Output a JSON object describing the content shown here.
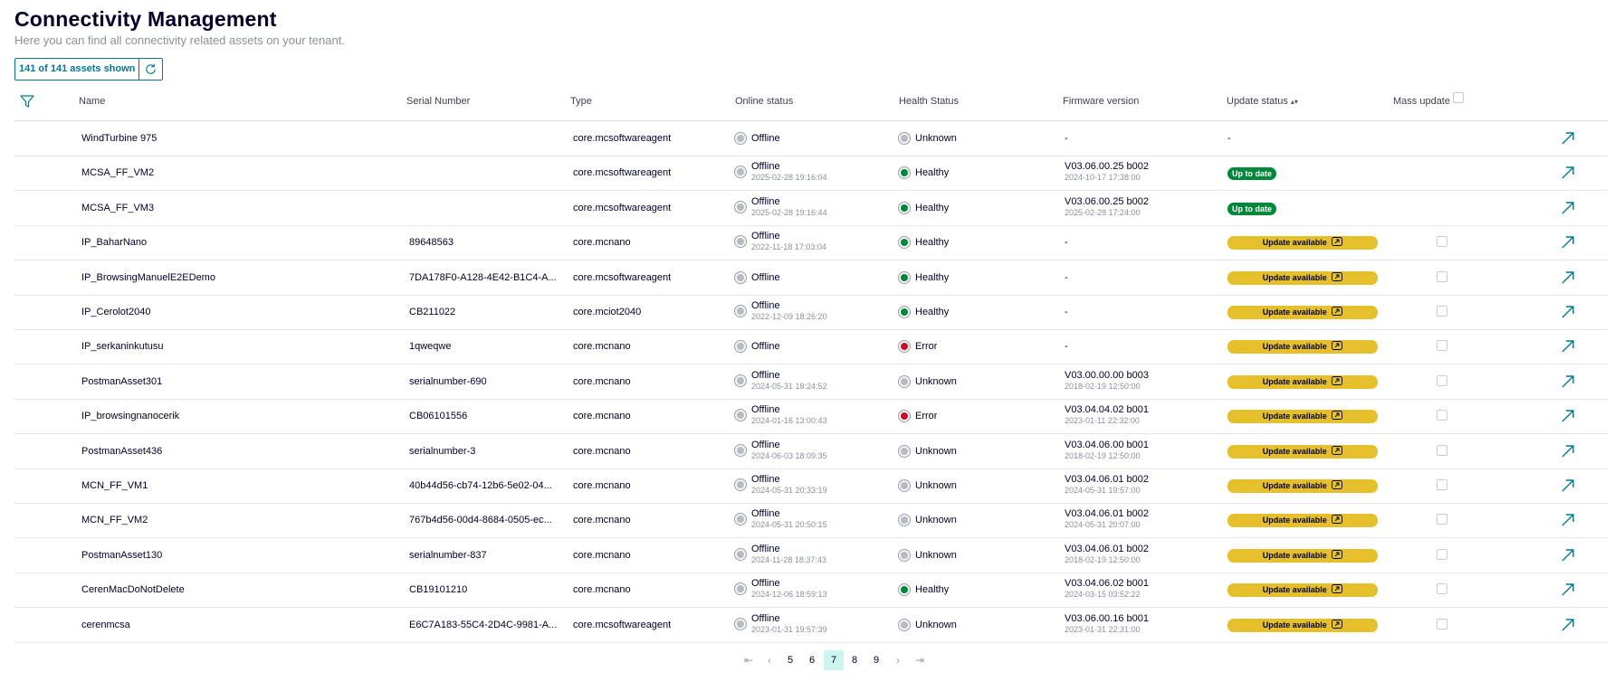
{
  "header": {
    "title": "Connectivity Management",
    "subtitle": "Here you can find all connectivity related assets on your tenant.",
    "count_label": "141 of 141 assets shown"
  },
  "columns": {
    "name": "Name",
    "serial": "Serial Number",
    "type": "Type",
    "online": "Online status",
    "health": "Health Status",
    "firmware": "Firmware version",
    "update": "Update status",
    "mass": "Mass update"
  },
  "colors": {
    "accent": "#007993",
    "healthy": "#00883a",
    "error": "#c8102e",
    "unknown": "#b7bcc2",
    "update_available": "#e6c02c"
  },
  "rows": [
    {
      "name": "WindTurbine 975",
      "serial": "",
      "type": "core.mcsoftwareagent",
      "online": "Offline",
      "online_time": "",
      "health": "Unknown",
      "firmware": "-",
      "firmware_date": "",
      "update": "-",
      "update_kind": "none"
    },
    {
      "name": "MCSA_FF_VM2",
      "serial": "",
      "type": "core.mcsoftwareagent",
      "online": "Offline",
      "online_time": "2025-02-28 19:16:04",
      "health": "Healthy",
      "firmware": "V03.06.00.25 b002",
      "firmware_date": "2024-10-17 17:38:00",
      "update": "Up to date",
      "update_kind": "uptodate"
    },
    {
      "name": "MCSA_FF_VM3",
      "serial": "",
      "type": "core.mcsoftwareagent",
      "online": "Offline",
      "online_time": "2025-02-28 19:16:44",
      "health": "Healthy",
      "firmware": "V03.06.00.25 b002",
      "firmware_date": "2025-02-28 17:24:00",
      "update": "Up to date",
      "update_kind": "uptodate"
    },
    {
      "name": "IP_BaharNano",
      "serial": "89648563",
      "type": "core.mcnano",
      "online": "Offline",
      "online_time": "2022-11-18 17:03:04",
      "health": "Healthy",
      "firmware": "-",
      "firmware_date": "",
      "update": "Update available",
      "update_kind": "available"
    },
    {
      "name": "IP_BrowsingManuelE2EDemo",
      "serial": "7DA178F0-A128-4E42-B1C4-A...",
      "type": "core.mcsoftwareagent",
      "online": "Offline",
      "online_time": "",
      "health": "Healthy",
      "firmware": "-",
      "firmware_date": "",
      "update": "Update available",
      "update_kind": "available"
    },
    {
      "name": "IP_Cerolot2040",
      "serial": "CB211022",
      "type": "core.mciot2040",
      "online": "Offline",
      "online_time": "2022-12-09 18:26:20",
      "health": "Healthy",
      "firmware": "-",
      "firmware_date": "",
      "update": "Update available",
      "update_kind": "available"
    },
    {
      "name": "IP_serkaninkutusu",
      "serial": "1qweqwe",
      "type": "core.mcnano",
      "online": "Offline",
      "online_time": "",
      "health": "Error",
      "firmware": "-",
      "firmware_date": "",
      "update": "Update available",
      "update_kind": "available"
    },
    {
      "name": "PostmanAsset301",
      "serial": "serialnumber-690",
      "type": "core.mcnano",
      "online": "Offline",
      "online_time": "2024-05-31 18:24:52",
      "health": "Unknown",
      "firmware": "V03.00.00.00 b003",
      "firmware_date": "2018-02-19 12:50:00",
      "update": "Update available",
      "update_kind": "available"
    },
    {
      "name": "IP_browsingnanocerik",
      "serial": "CB06101556",
      "type": "core.mcnano",
      "online": "Offline",
      "online_time": "2024-01-16 13:00:43",
      "health": "Error",
      "firmware": "V03.04.04.02 b001",
      "firmware_date": "2023-01-11 22:32:00",
      "update": "Update available",
      "update_kind": "available"
    },
    {
      "name": "PostmanAsset436",
      "serial": "serialnumber-3",
      "type": "core.mcnano",
      "online": "Offline",
      "online_time": "2024-06-03 18:09:35",
      "health": "Unknown",
      "firmware": "V03.04.06.00 b001",
      "firmware_date": "2018-02-19 12:50:00",
      "update": "Update available",
      "update_kind": "available"
    },
    {
      "name": "MCN_FF_VM1",
      "serial": "40b44d56-cb74-12b6-5e02-04...",
      "type": "core.mcnano",
      "online": "Offline",
      "online_time": "2024-05-31 20:33:19",
      "health": "Unknown",
      "firmware": "V03.04.06.01 b002",
      "firmware_date": "2024-05-31 19:57:00",
      "update": "Update available",
      "update_kind": "available"
    },
    {
      "name": "MCN_FF_VM2",
      "serial": "767b4d56-00d4-8684-0505-ec...",
      "type": "core.mcnano",
      "online": "Offline",
      "online_time": "2024-05-31 20:50:15",
      "health": "Unknown",
      "firmware": "V03.04.06.01 b002",
      "firmware_date": "2024-05-31 20:07:00",
      "update": "Update available",
      "update_kind": "available"
    },
    {
      "name": "PostmanAsset130",
      "serial": "serialnumber-837",
      "type": "core.mcnano",
      "online": "Offline",
      "online_time": "2024-11-28 18:37:43",
      "health": "Unknown",
      "firmware": "V03.04.06.01 b002",
      "firmware_date": "2018-02-19 12:50:00",
      "update": "Update available",
      "update_kind": "available"
    },
    {
      "name": "CerenMacDoNotDelete",
      "serial": "CB19101210",
      "type": "core.mcnano",
      "online": "Offline",
      "online_time": "2024-12-06 18:59:13",
      "health": "Healthy",
      "firmware": "V03.04.06.02 b001",
      "firmware_date": "2024-03-15 03:52:22",
      "update": "Update available",
      "update_kind": "available"
    },
    {
      "name": "cerenmcsa",
      "serial": "E6C7A183-55C4-2D4C-9981-A...",
      "type": "core.mcsoftwareagent",
      "online": "Offline",
      "online_time": "2023-01-31 19:57:39",
      "health": "Unknown",
      "firmware": "V03.06.00.16 b001",
      "firmware_date": "2023-01-31 22:31:00",
      "update": "Update available",
      "update_kind": "available"
    }
  ],
  "pagination": {
    "pages": [
      "5",
      "6",
      "7",
      "8",
      "9"
    ],
    "current": "7",
    "first": "⇤",
    "prev": "‹",
    "next": "›",
    "last": "⇥"
  }
}
